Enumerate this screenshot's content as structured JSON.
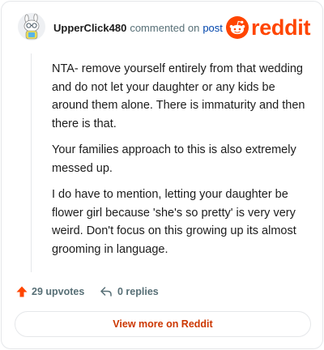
{
  "header": {
    "username": "UpperClick480",
    "action_text": "commented on",
    "post_link_text": "post",
    "logo_text": "reddit"
  },
  "comment": {
    "paragraphs": [
      "NTA- remove yourself entirely from that wedding and do not let your daughter or any kids be around them alone. There is immaturity and then there is that.",
      "Your families approach to this is also extremely messed up.",
      "I do have to mention, letting your daughter be flower girl because 'she's so pretty' is very very weird. Don't focus on this growing up its almost grooming in language."
    ]
  },
  "actions": {
    "upvotes_label": "29 upvotes",
    "replies_label": "0 replies"
  },
  "footer": {
    "view_more_label": "View more on Reddit"
  },
  "colors": {
    "brand": "#ff4500",
    "link": "#0045ac",
    "muted": "#576f76",
    "cta_text": "#cc3700"
  },
  "icons": {
    "avatar": "snoo-avatar-icon",
    "logo": "reddit-snoo-icon",
    "upvote": "upvote-arrow-icon",
    "reply": "reply-arrow-icon"
  }
}
